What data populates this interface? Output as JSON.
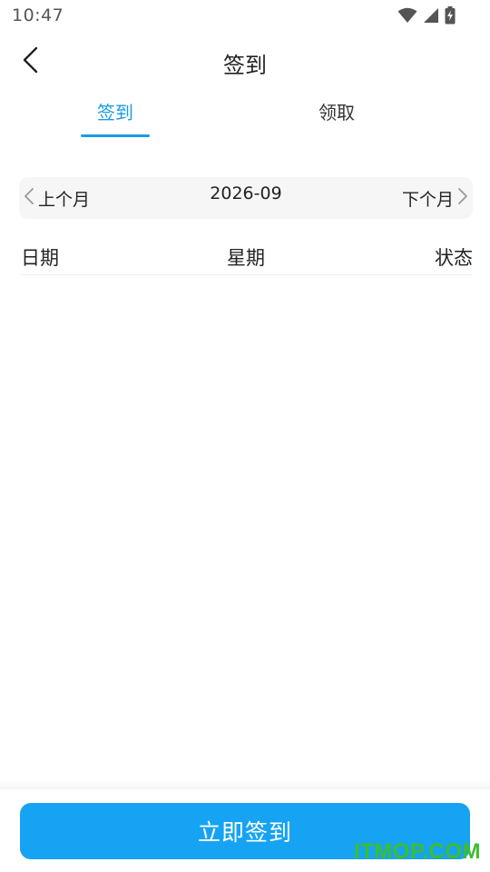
{
  "status_bar": {
    "time": "10:47",
    "icons": [
      "wifi-icon",
      "cell-signal-icon",
      "battery-charging-icon"
    ]
  },
  "header": {
    "title": "签到",
    "back_icon": "chevron-left-icon"
  },
  "tabs": [
    {
      "label": "签到",
      "active": true
    },
    {
      "label": "领取",
      "active": false
    }
  ],
  "month_nav": {
    "prev_label": "上个月",
    "current": "2026-09",
    "next_label": "下个月"
  },
  "table": {
    "columns": [
      "日期",
      "星期",
      "状态"
    ],
    "rows": []
  },
  "action": {
    "signin_label": "立即签到"
  },
  "watermark": "ITMOP.COM",
  "colors": {
    "accent": "#1a9be8",
    "button": "#16a3f3",
    "watermark": "#3cbf2a"
  }
}
